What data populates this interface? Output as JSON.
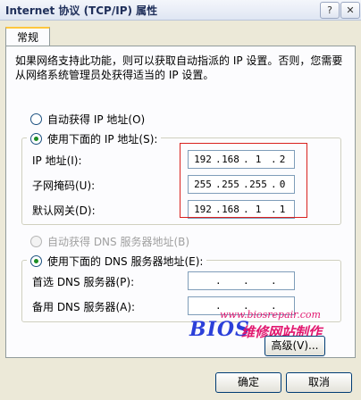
{
  "window": {
    "title": "Internet 协议 (TCP/IP) 属性",
    "help_label": "?",
    "close_label": "✕"
  },
  "tabs": [
    {
      "label": "常规"
    }
  ],
  "description": "如果网络支持此功能，则可以获取自动指派的 IP 设置。否则，您需要从网络系统管理员处获得适当的 IP 设置。",
  "ip_section": {
    "auto_radio_label": "自动获得 IP 地址(O)",
    "manual_radio_label": "使用下面的 IP 地址(S):",
    "fields": [
      {
        "label": "IP 地址(I):",
        "octets": [
          "192",
          "168",
          "1",
          "2"
        ]
      },
      {
        "label": "子网掩码(U):",
        "octets": [
          "255",
          "255",
          "255",
          "0"
        ]
      },
      {
        "label": "默认网关(D):",
        "octets": [
          "192",
          "168",
          "1",
          "1"
        ]
      }
    ]
  },
  "dns_section": {
    "auto_radio_label": "自动获得 DNS 服务器地址(B)",
    "manual_radio_label": "使用下面的 DNS 服务器地址(E):",
    "fields": [
      {
        "label": "首选 DNS 服务器(P):"
      },
      {
        "label": "备用 DNS 服务器(A):"
      }
    ]
  },
  "dot_char": ".",
  "advanced_label": "高级(V)...",
  "ok_label": "确定",
  "cancel_label": "取消",
  "watermark": {
    "url": "www.biosrepair.com",
    "brand": "BIOS",
    "chinese": "维修网站制作"
  },
  "colors": {
    "highlight_border": "#d9211e",
    "watermark_pink": "#e2186f",
    "watermark_blue": "#2b3fd9"
  }
}
